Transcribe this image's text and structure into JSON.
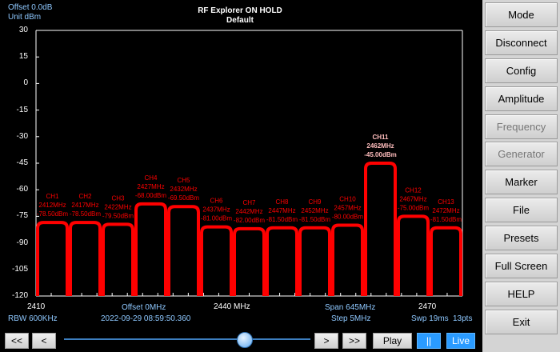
{
  "header": {
    "offset": "Offset 0.0dB",
    "unit": "Unit dBm",
    "title": "RF Explorer ON HOLD",
    "subtitle": "Default"
  },
  "footer": {
    "left_freq": "2410",
    "center_freq": "2440 MHz",
    "right_freq": "2470",
    "offset": "Offset 0MHz",
    "span": "Span 645MHz",
    "rbw": "RBW 600KHz",
    "datetime": "2022-09-29 08:59:50.360",
    "step": "Step 5MHz",
    "sweep": "Swp 19ms",
    "points": "13pts"
  },
  "side_menu": {
    "mode": "Mode",
    "disconnect": "Disconnect",
    "config": "Config",
    "amplitude": "Amplitude",
    "frequency": "Frequency",
    "generator": "Generator",
    "marker": "Marker",
    "file": "File",
    "presets": "Presets",
    "full_screen": "Full Screen",
    "help": "HELP",
    "exit": "Exit"
  },
  "bottom_bar": {
    "first": "<<",
    "prev": "<",
    "next": ">",
    "last": ">>",
    "play": "Play",
    "pause": "||",
    "live": "Live",
    "slider_position": 0.73
  },
  "colors": {
    "trace": "#ff0000",
    "peak_label": "#ffbdbd",
    "info_text": "#8ec8ff",
    "active_button": "#2a9bff"
  },
  "chart_data": {
    "type": "bar",
    "ylabel": "Unit dBm",
    "ylim": [
      -120,
      30
    ],
    "y_ticks": [
      "30",
      "15",
      "0",
      "-15",
      "-30",
      "-45",
      "-60",
      "-75",
      "-90",
      "-105",
      "-120"
    ],
    "grid": false,
    "highlight_index": 10,
    "categories": [
      "CH1",
      "CH2",
      "CH3",
      "CH4",
      "CH5",
      "CH6",
      "CH7",
      "CH8",
      "CH9",
      "CH10",
      "CH11",
      "CH12",
      "CH13"
    ],
    "frequencies": [
      "2412MHz",
      "2417MHz",
      "2422MHz",
      "2427MHz",
      "2432MHz",
      "2437MHz",
      "2442MHz",
      "2447MHz",
      "2452MHz",
      "2457MHz",
      "2462MHz",
      "2467MHz",
      "2472MHz"
    ],
    "labels": [
      "-78.50dBm",
      "-78.50dBm",
      "-79.50dBm",
      "-68.00dBm",
      "-69.50dBm",
      "-81.00dBm",
      "-82.00dBm",
      "-81.50dBm",
      "-81.50dBm",
      "-80.00dBm",
      "-45.00dBm",
      "-75.00dBm",
      "-81.50dBm"
    ],
    "values": [
      -78.5,
      -78.5,
      -79.5,
      -68,
      -69.5,
      -81,
      -82,
      -81.5,
      -81.5,
      -80,
      -45,
      -75,
      -81.5
    ]
  }
}
